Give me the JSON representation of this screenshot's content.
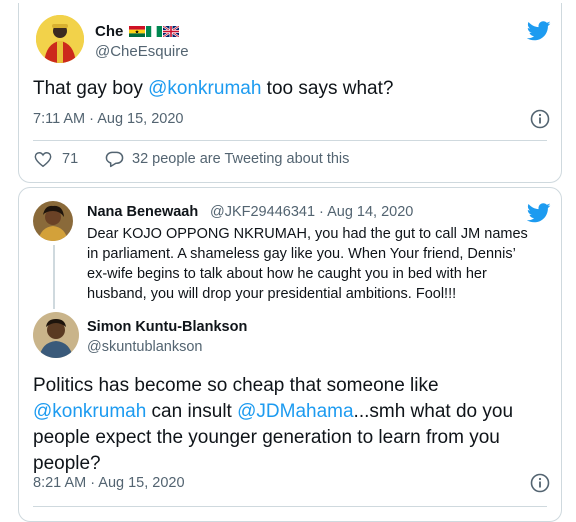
{
  "colors": {
    "accent": "#1d9bf0",
    "text": "#0f1419",
    "muted": "#536471",
    "border": "#cfd9de"
  },
  "tweet1": {
    "name": "Che",
    "name_flags": [
      "ghana-flag-icon",
      "nigeria-flag-icon",
      "uk-flag-icon"
    ],
    "handle": "@CheEsquire",
    "text_pre": "That gay boy ",
    "text_link": "@konkrumah",
    "text_post": " too says what?",
    "timestamp": "7:11 AM · Aug 15, 2020",
    "likes": "71",
    "conversation": "32 people are Tweeting about this"
  },
  "quoted": {
    "name": "Nana Benewaah",
    "handle_date": "@JKF29446341 · Aug 14, 2020",
    "lines": [
      "Dear KOJO OPPONG NKRUMAH, you had the gut to call JM names",
      "in parliament. A shameless gay like you. When Your friend, Dennis’",
      "ex-wife begins to talk about how he caught you in bed with her",
      "husband, you will drop your presidential ambitions. Fool!!!"
    ]
  },
  "tweet2": {
    "name": "Simon Kuntu-Blankson",
    "handle": "@skuntublankson",
    "line1": "Politics has become so cheap that someone like",
    "line2_link1": "@konkrumah",
    "line2_mid": " can insult ",
    "line2_link2": "@JDMahama",
    "line2_post": "...smh what do you",
    "line3": "people expect the younger generation to learn from you",
    "line4": "people?",
    "timestamp": "8:21 AM · Aug 15, 2020"
  }
}
